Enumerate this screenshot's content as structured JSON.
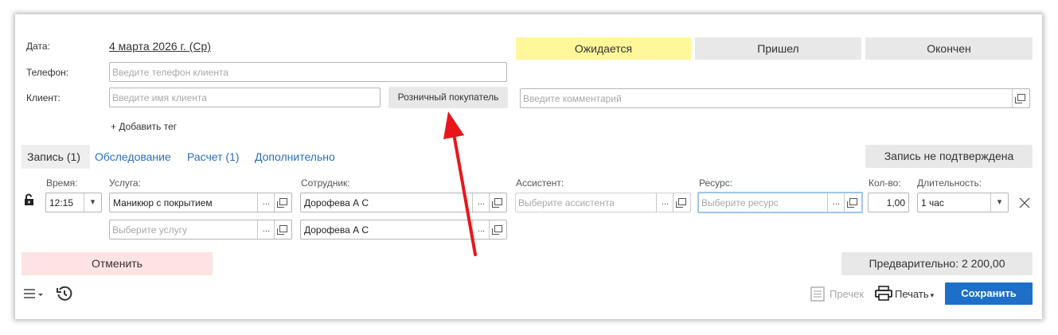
{
  "form": {
    "date_label": "Дата:",
    "date_value": "4 марта 2026 г. (Ср)",
    "phone_label": "Телефон:",
    "phone_placeholder": "Введите телефон клиента",
    "client_label": "Клиент:",
    "client_placeholder": "Введите имя клиента",
    "retail_button": "Розничный покупатель",
    "comment_placeholder": "Введите комментарий",
    "add_tag": "+ Добавить тег"
  },
  "status": {
    "waiting": "Ожидается",
    "arrived": "Пришел",
    "finished": "Окончен",
    "waiting_color": "#fff799"
  },
  "tabs": {
    "active": "Запись (1)",
    "items": [
      "Обследование",
      "Расчет (1)",
      "Дополнительно"
    ]
  },
  "unconfirmed_button": "Запись не подтверждена",
  "columns": {
    "time": "Время:",
    "service": "Услуга:",
    "employee": "Сотрудник:",
    "assistant": "Ассистент:",
    "resource": "Ресурс:",
    "qty": "Кол-во:",
    "duration": "Длительность:"
  },
  "row": {
    "time": "12:15",
    "service": "Маникюр с покрытием",
    "service_placeholder": "Выберите услугу",
    "employee": "Дорофева А С",
    "employee2": "Дорофева А С",
    "assistant_placeholder": "Выберите ассистента",
    "resource_placeholder": "Выберите ресурс",
    "qty": "1,00",
    "duration": "1 час",
    "dots": "..."
  },
  "footer": {
    "cancel": "Отменить",
    "preliminary": "Предварительно: 2 200,00",
    "receipt": "Пречек",
    "print": "Печать",
    "save": "Сохранить",
    "save_color": "#1e6fc8",
    "cancel_color": "#fde3e3"
  },
  "annotation": {
    "arrow_color": "#e8161b"
  }
}
